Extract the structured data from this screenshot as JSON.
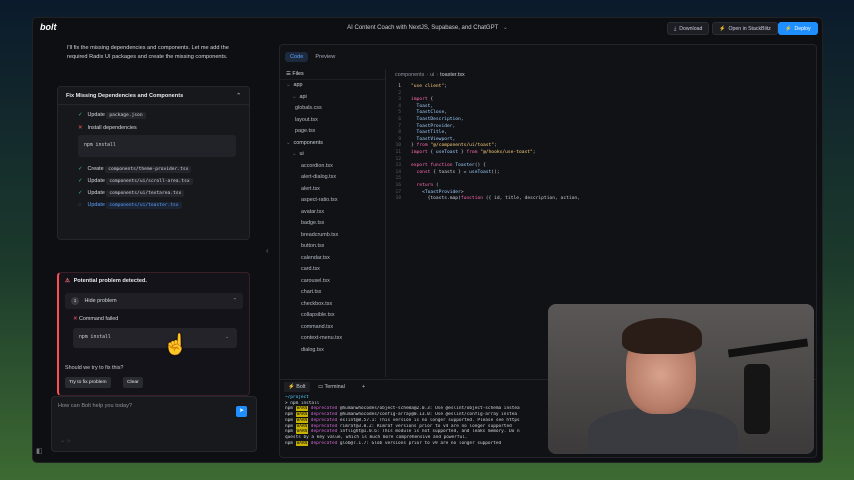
{
  "topbar": {
    "logo": "bolt",
    "project_title": "AI Content Coach with NextJS, Supabase, and ChatGPT",
    "download_label": "Download",
    "stackblitz_label": "Open in StackBlitz",
    "deploy_label": "Deploy"
  },
  "chat": {
    "message": "I'll fix the missing dependencies and components. Let me add the required Radix UI packages and create the missing components.",
    "card": {
      "title": "Fix Missing Dependencies and Components",
      "steps": [
        {
          "status": "done",
          "verb": "Update",
          "target": "package.json"
        },
        {
          "status": "failed",
          "verb": "Install dependencies",
          "target": ""
        },
        {
          "status": "done",
          "verb": "Create",
          "target": "components/theme-provider.tsx"
        },
        {
          "status": "done",
          "verb": "Update",
          "target": "components/ui/scroll-area.tsx"
        },
        {
          "status": "done",
          "verb": "Update",
          "target": "components/ui/textarea.tsx"
        },
        {
          "status": "running",
          "verb": "Update",
          "target": "components/ui/toaster.tsx"
        }
      ],
      "command": "npm install"
    },
    "problem": {
      "title": "Potential problem detected.",
      "hide_label": "Hide problem",
      "hide_number": "1",
      "command_failed": "Command failed",
      "command": "npm install",
      "question": "Should we try to fix this?",
      "try_fix_label": "Try to fix problem",
      "clear_label": "Clear"
    },
    "input_placeholder": "How can Bolt help you today?"
  },
  "workbench": {
    "tabs": [
      "Code",
      "Preview"
    ],
    "active_tab": "Code",
    "files_header": "Files",
    "tree": [
      {
        "label": "app",
        "folder": true,
        "depth": 0
      },
      {
        "label": "api",
        "folder": true,
        "depth": 1
      },
      {
        "label": "globals.css",
        "folder": false,
        "depth": 1
      },
      {
        "label": "layout.tsx",
        "folder": false,
        "depth": 1
      },
      {
        "label": "page.tsx",
        "folder": false,
        "depth": 1
      },
      {
        "label": "components",
        "folder": true,
        "depth": 0
      },
      {
        "label": "ui",
        "folder": true,
        "depth": 1
      },
      {
        "label": "accordion.tsx",
        "folder": false,
        "depth": 2
      },
      {
        "label": "alert-dialog.tsx",
        "folder": false,
        "depth": 2
      },
      {
        "label": "alert.tsx",
        "folder": false,
        "depth": 2
      },
      {
        "label": "aspect-ratio.tsx",
        "folder": false,
        "depth": 2
      },
      {
        "label": "avatar.tsx",
        "folder": false,
        "depth": 2
      },
      {
        "label": "badge.tsx",
        "folder": false,
        "depth": 2
      },
      {
        "label": "breadcrumb.tsx",
        "folder": false,
        "depth": 2
      },
      {
        "label": "button.tsx",
        "folder": false,
        "depth": 2
      },
      {
        "label": "calendar.tsx",
        "folder": false,
        "depth": 2
      },
      {
        "label": "card.tsx",
        "folder": false,
        "depth": 2
      },
      {
        "label": "carousel.tsx",
        "folder": false,
        "depth": 2
      },
      {
        "label": "chart.tsx",
        "folder": false,
        "depth": 2
      },
      {
        "label": "checkbox.tsx",
        "folder": false,
        "depth": 2
      },
      {
        "label": "collapsible.tsx",
        "folder": false,
        "depth": 2
      },
      {
        "label": "command.tsx",
        "folder": false,
        "depth": 2
      },
      {
        "label": "context-menu.tsx",
        "folder": false,
        "depth": 2
      },
      {
        "label": "dialog.tsx",
        "folder": false,
        "depth": 2
      }
    ],
    "breadcrumb": [
      "components",
      "ui",
      "toaster.tsx"
    ],
    "code_lines": [
      "\"use client\";",
      "",
      "import {",
      "  Toast,",
      "  ToastClose,",
      "  ToastDescription,",
      "  ToastProvider,",
      "  ToastTitle,",
      "  ToastViewport,",
      "} from \"@/components/ui/toast\";",
      "import { useToast } from \"@/hooks/use-toast\";",
      "",
      "export function Toaster() {",
      "  const { toasts } = useToast();",
      "",
      "  return (",
      "    <ToastProvider>",
      "      {toasts.map(function ({ id, title, description, action,"
    ],
    "terminal_tabs": [
      "Bolt",
      "Terminal"
    ],
    "terminal": {
      "path": "~/project",
      "prompt": "> npm install",
      "lines": [
        {
          "pkg": "@humanwhocodes/object-schema@2.0.3",
          "msg": "Use @eslint/object-schema instea"
        },
        {
          "pkg": "@humanwhocodes/config-array@0.13.0",
          "msg": "Use @eslint/config-array instea"
        },
        {
          "pkg": "eslint@8.57.1",
          "msg": "This version is no longer supported. Please see https"
        },
        {
          "pkg": "rimraf@3.0.2",
          "msg": "Rimraf versions prior to v4 are no longer supported"
        },
        {
          "pkg": "inflight@1.0.6",
          "msg": "This module is not supported, and leaks memory. Do n"
        },
        {
          "pkg": "",
          "msg": "quests by a key value, which is much more comprehensive and powerful."
        },
        {
          "pkg": "glob@7.1.7",
          "msg": "Glob versions prior to v9 are no longer supported"
        }
      ]
    }
  }
}
